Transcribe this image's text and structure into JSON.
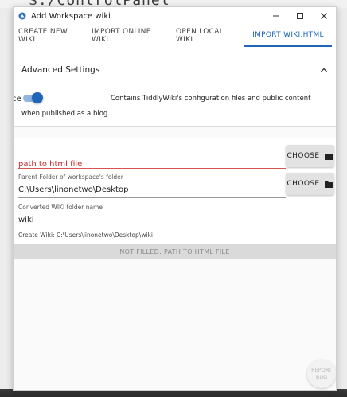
{
  "background": {
    "path_text": "$./ControlPanel"
  },
  "window": {
    "title": "Add Workspace wiki",
    "controls": {
      "minimize": "—",
      "maximize": "☐",
      "close": "✕"
    }
  },
  "tabs": [
    {
      "label": "CREATE NEW WIKI",
      "active": false
    },
    {
      "label": "IMPORT ONLINE WIKI",
      "active": false
    },
    {
      "label": "OPEN LOCAL WIKI",
      "active": false
    },
    {
      "label": "IMPORT WIKI.HTML",
      "active": true
    }
  ],
  "advanced": {
    "title": "Advanced Settings",
    "main_workspace_label": "Main Workspace",
    "main_workspace_on": true,
    "description": "Contains TiddlyWiki's configuration files and public content when published as a blog."
  },
  "form": {
    "html_path": {
      "placeholder": "path to html file",
      "value": ""
    },
    "parent_folder": {
      "label": "Parent Folder of workspace's folder",
      "value": "C:\\Users\\linonetwo\\Desktop"
    },
    "wiki_folder": {
      "label": "Converted WIKI folder name",
      "value": "wiki"
    },
    "choose_label": "CHOOSE",
    "create_info": "Create Wiki: C:\\Users\\linonetwo\\Desktop\\wiki"
  },
  "status": {
    "message": "NOT FILLED:  PATH TO HTML FILE"
  },
  "report_bug": {
    "line1": "REPORT",
    "line2": "BUG"
  },
  "colors": {
    "accent": "#1f66b8",
    "error": "#c62828",
    "status_bg": "#dadada"
  }
}
